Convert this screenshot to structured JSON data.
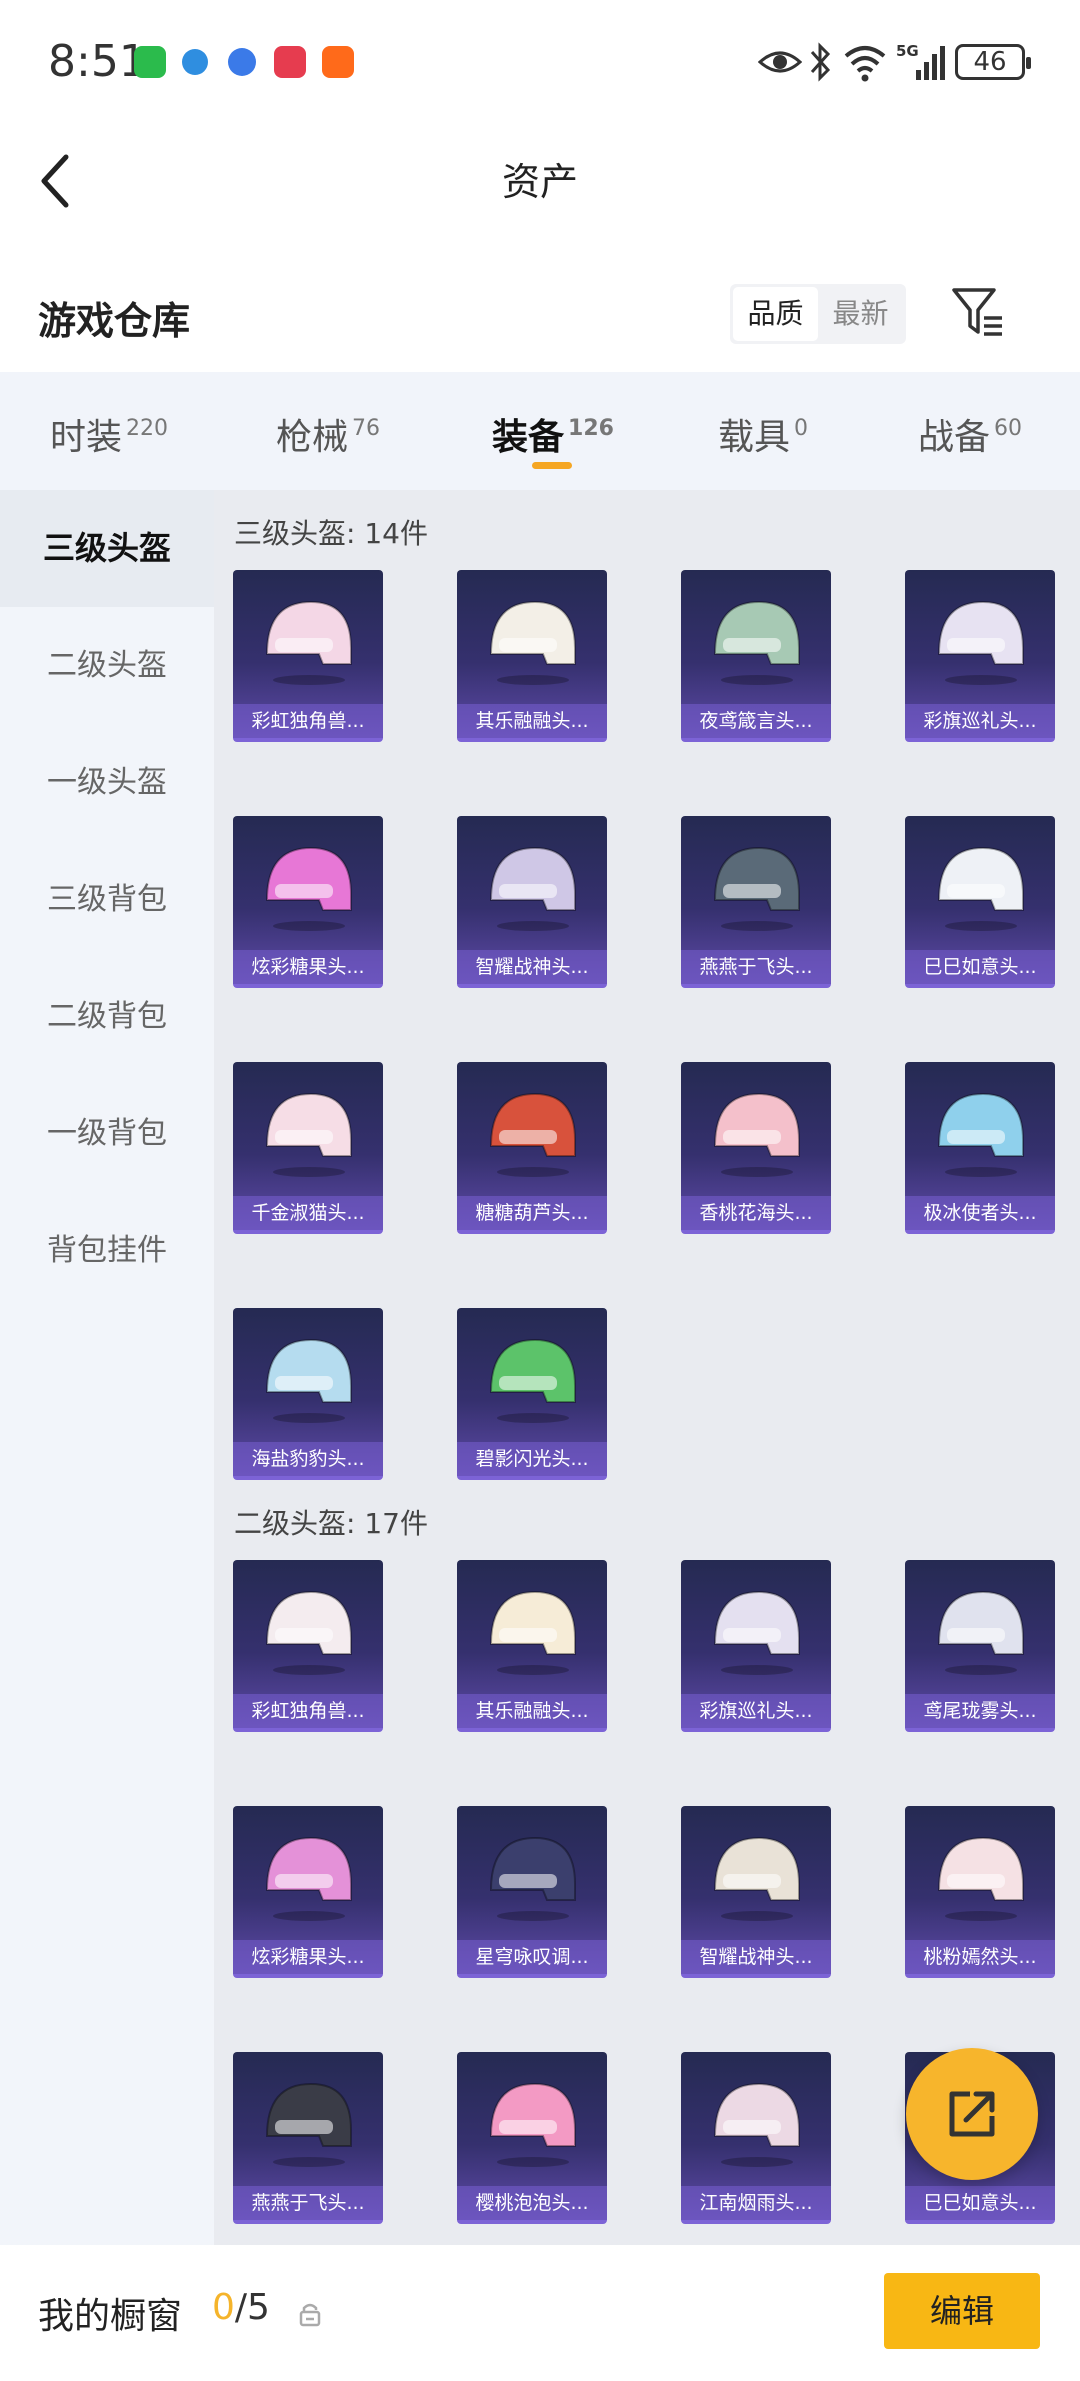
{
  "status_bar": {
    "time": "8:51",
    "battery": "46"
  },
  "nav": {
    "title": "资产"
  },
  "warehouse": {
    "title": "游戏仓库",
    "sort_quality": "品质",
    "sort_newest": "最新"
  },
  "tabs": [
    {
      "label": "时装",
      "count": "220"
    },
    {
      "label": "枪械",
      "count": "76"
    },
    {
      "label": "装备",
      "count": "126"
    },
    {
      "label": "载具",
      "count": "0"
    },
    {
      "label": "战备",
      "count": "60"
    }
  ],
  "sidebar": [
    "三级头盔",
    "二级头盔",
    "一级头盔",
    "三级背包",
    "二级背包",
    "一级背包",
    "背包挂件"
  ],
  "sections": [
    {
      "title": "三级头盔: 14件",
      "items": [
        {
          "name": "彩虹独角兽...",
          "color": "#f4d7e6"
        },
        {
          "name": "其乐融融头...",
          "color": "#f3efe7"
        },
        {
          "name": "夜鸢箴言头...",
          "color": "#a7c9b4"
        },
        {
          "name": "彩旗巡礼头...",
          "color": "#e7e2f2"
        },
        {
          "name": "炫彩糖果头...",
          "color": "#e777d6"
        },
        {
          "name": "智耀战神头...",
          "color": "#cfc7e6"
        },
        {
          "name": "燕燕于飞头...",
          "color": "#5a6a78"
        },
        {
          "name": "巳巳如意头...",
          "color": "#eef1f6"
        },
        {
          "name": "千金淑猫头...",
          "color": "#f6dde6"
        },
        {
          "name": "糖糖葫芦头...",
          "color": "#d8523c"
        },
        {
          "name": "香桃花海头...",
          "color": "#f4c0cb"
        },
        {
          "name": "极冰使者头...",
          "color": "#8fd0ec"
        },
        {
          "name": "海盐豹豹头...",
          "color": "#b5dcef"
        },
        {
          "name": "碧影闪光头...",
          "color": "#5cc36a"
        }
      ]
    },
    {
      "title": "二级头盔: 17件",
      "items": [
        {
          "name": "彩虹独角兽...",
          "color": "#f4ecef"
        },
        {
          "name": "其乐融融头...",
          "color": "#f6ecd7"
        },
        {
          "name": "彩旗巡礼头...",
          "color": "#e4e0f0"
        },
        {
          "name": "鸢尾珑雾头...",
          "color": "#e0e2ee"
        },
        {
          "name": "炫彩糖果头...",
          "color": "#e491d8"
        },
        {
          "name": "星穹咏叹调...",
          "color": "#3b3f6d"
        },
        {
          "name": "智耀战神头...",
          "color": "#e9e2d7"
        },
        {
          "name": "桃粉嫣然头...",
          "color": "#f5e1e4"
        },
        {
          "name": "燕燕于飞头...",
          "color": "#3a3c47"
        },
        {
          "name": "樱桃泡泡头...",
          "color": "#f39ac4"
        },
        {
          "name": "江南烟雨头...",
          "color": "#ecd9e4"
        },
        {
          "name": "巳巳如意头...",
          "color": "#eef1f6"
        }
      ]
    }
  ],
  "bottom_bar": {
    "label": "我的橱窗",
    "current": "0",
    "total": "/5",
    "edit": "编辑"
  },
  "colors": {
    "accent": "#f8b714",
    "indicator": "#f5a623"
  }
}
